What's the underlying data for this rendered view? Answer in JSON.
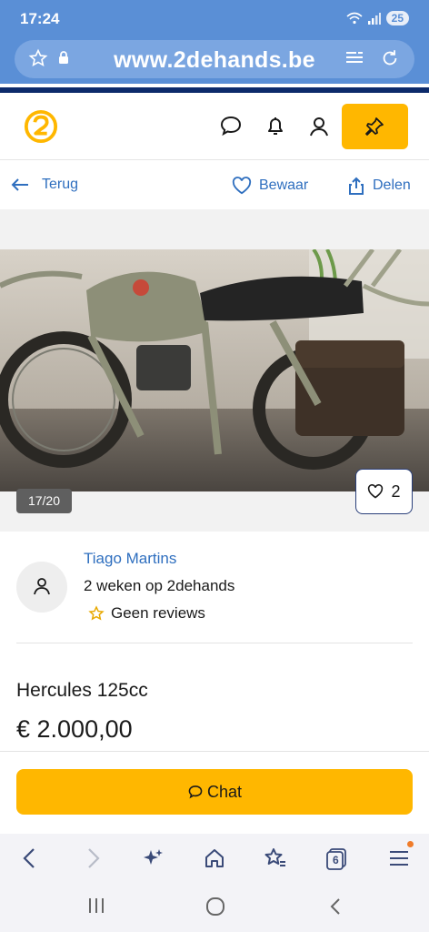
{
  "status_bar": {
    "time": "17:24",
    "battery": "25"
  },
  "browser": {
    "url": "www.2dehands.be",
    "tab_count": "6"
  },
  "actions": {
    "back": "Terug",
    "save": "Bewaar",
    "share": "Delen"
  },
  "gallery": {
    "counter": "17/20",
    "favorites": "2"
  },
  "seller": {
    "name": "Tiago Martins",
    "member_since": "2 weken op 2dehands",
    "reviews": "Geen reviews"
  },
  "listing": {
    "title": "Hercules 125cc",
    "price": "€ 2.000,00"
  },
  "chat": {
    "label": "Chat"
  },
  "colors": {
    "brand_yellow": "#ffb700",
    "link_blue": "#2f6fbf",
    "browser_blue": "#5a8fd6",
    "navy": "#0d2b6b"
  },
  "icons": [
    "star-icon",
    "lock-icon",
    "reader-icon",
    "reload-icon",
    "logo-icon",
    "message-icon",
    "bell-icon",
    "user-icon",
    "pin-icon",
    "arrow-left-icon",
    "heart-icon",
    "share-icon",
    "back-icon",
    "forward-icon",
    "sparkle-icon",
    "home-icon",
    "bookmarks-icon",
    "tabs-icon",
    "menu-icon"
  ]
}
